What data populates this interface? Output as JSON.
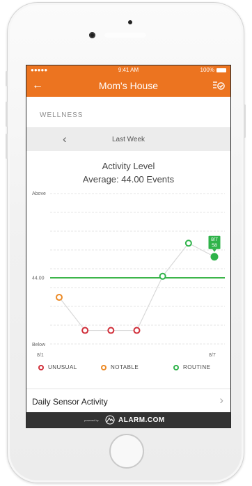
{
  "status": {
    "signal": "●●●●● ",
    "time": "9:41 AM",
    "battery": "100%"
  },
  "nav": {
    "back_icon": "arrow-left-icon",
    "title": "Mom's House",
    "filter_icon": "filter-check-icon"
  },
  "section": {
    "label": "WELLNESS"
  },
  "week": {
    "prev_icon": "chevron-left-icon",
    "label": "Last Week"
  },
  "chart": {
    "title": "Activity Level",
    "subtitle": "Average: 44.00 Events"
  },
  "chart_data": {
    "type": "line",
    "title": "Activity Level",
    "subtitle": "Average: 44.00 Events",
    "y_top_label": "Above",
    "y_bottom_label": "Below",
    "average_label": "44.00",
    "x_start_label": "8/1",
    "x_end_label": "8/7",
    "average_value": 44.0,
    "ylim": [
      0,
      100
    ],
    "points": [
      {
        "day": 1,
        "value": 31,
        "status": "notable"
      },
      {
        "day": 2,
        "value": 9,
        "status": "unusual"
      },
      {
        "day": 3,
        "value": 9,
        "status": "unusual"
      },
      {
        "day": 4,
        "value": 9,
        "status": "unusual"
      },
      {
        "day": 5,
        "value": 45,
        "status": "routine"
      },
      {
        "day": 6,
        "value": 67,
        "status": "routine"
      },
      {
        "day": 7,
        "value": 58,
        "status": "routine"
      }
    ],
    "tooltip": {
      "date": "8/7",
      "value": "58"
    },
    "colors": {
      "unusual": "#d1303b",
      "notable": "#ec8a26",
      "routine": "#2fb34a",
      "average_line": "#3cb54a"
    }
  },
  "legend": [
    {
      "label": "UNUSUAL",
      "color": "#d1303b"
    },
    {
      "label": "NOTABLE",
      "color": "#ec8a26"
    },
    {
      "label": "ROUTINE",
      "color": "#2fb34a"
    }
  ],
  "daily": {
    "label": "Daily Sensor Activity",
    "chevron_icon": "chevron-right-icon"
  },
  "footer": {
    "powered": "powered by",
    "brand": "ALARM.COM",
    "logo_icon": "alarm-com-logo-icon"
  },
  "brand_colors": {
    "accent": "#ec7420",
    "footer": "#333333"
  }
}
